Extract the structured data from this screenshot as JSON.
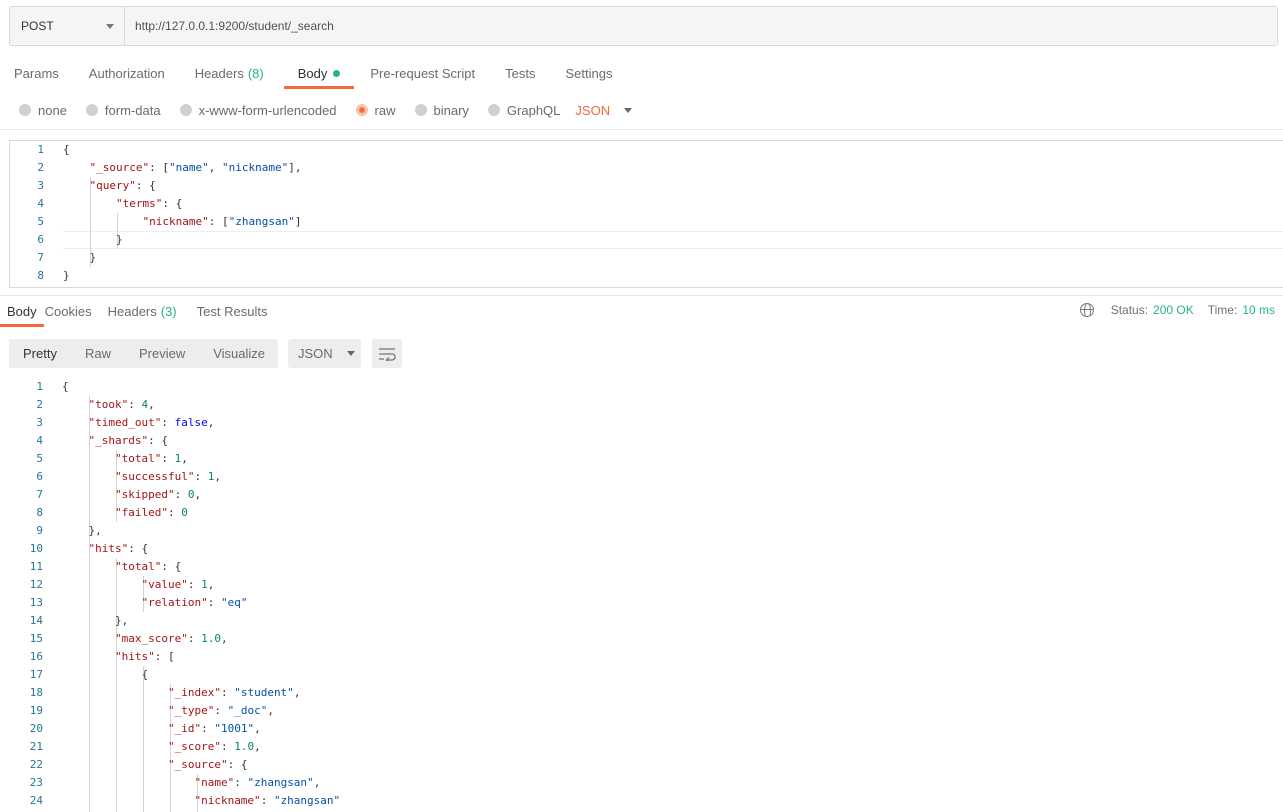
{
  "request": {
    "method": "POST",
    "url": "http://127.0.0.1:9200/student/_search"
  },
  "request_tabs": [
    {
      "label": "Params",
      "count": ""
    },
    {
      "label": "Authorization",
      "count": ""
    },
    {
      "label": "Headers",
      "count": "(8)"
    },
    {
      "label": "Body",
      "count": ""
    },
    {
      "label": "Pre-request Script",
      "count": ""
    },
    {
      "label": "Tests",
      "count": ""
    },
    {
      "label": "Settings",
      "count": ""
    }
  ],
  "body_types": [
    "none",
    "form-data",
    "x-www-form-urlencoded",
    "raw",
    "binary",
    "GraphQL"
  ],
  "body_format": "JSON",
  "request_body_lines": [
    "{",
    "    \"_source\": [\"name\", \"nickname\"],",
    "    \"query\": {",
    "        \"terms\": {",
    "            \"nickname\": [\"zhangsan\"]",
    "        }",
    "    }",
    "}"
  ],
  "response_tabs": [
    {
      "label": "Body",
      "count": ""
    },
    {
      "label": "Cookies",
      "count": ""
    },
    {
      "label": "Headers",
      "count": "(3)"
    },
    {
      "label": "Test Results",
      "count": ""
    }
  ],
  "status": {
    "status_label": "Status:",
    "status_value": "200 OK",
    "time_label": "Time:",
    "time_value": "10 ms"
  },
  "view_modes": [
    "Pretty",
    "Raw",
    "Preview",
    "Visualize"
  ],
  "response_format": "JSON",
  "response_body_lines": [
    "{",
    "    \"took\": 4,",
    "    \"timed_out\": false,",
    "    \"_shards\": {",
    "        \"total\": 1,",
    "        \"successful\": 1,",
    "        \"skipped\": 0,",
    "        \"failed\": 0",
    "    },",
    "    \"hits\": {",
    "        \"total\": {",
    "            \"value\": 1,",
    "            \"relation\": \"eq\"",
    "        },",
    "        \"max_score\": 1.0,",
    "        \"hits\": [",
    "            {",
    "                \"_index\": \"student\",",
    "                \"_type\": \"_doc\",",
    "                \"_id\": \"1001\",",
    "                \"_score\": 1.0,",
    "                \"_source\": {",
    "                    \"name\": \"zhangsan\",",
    "                    \"nickname\": \"zhangsan\""
  ],
  "colors": {
    "accent": "#f26b3a",
    "success": "#26b47f"
  }
}
